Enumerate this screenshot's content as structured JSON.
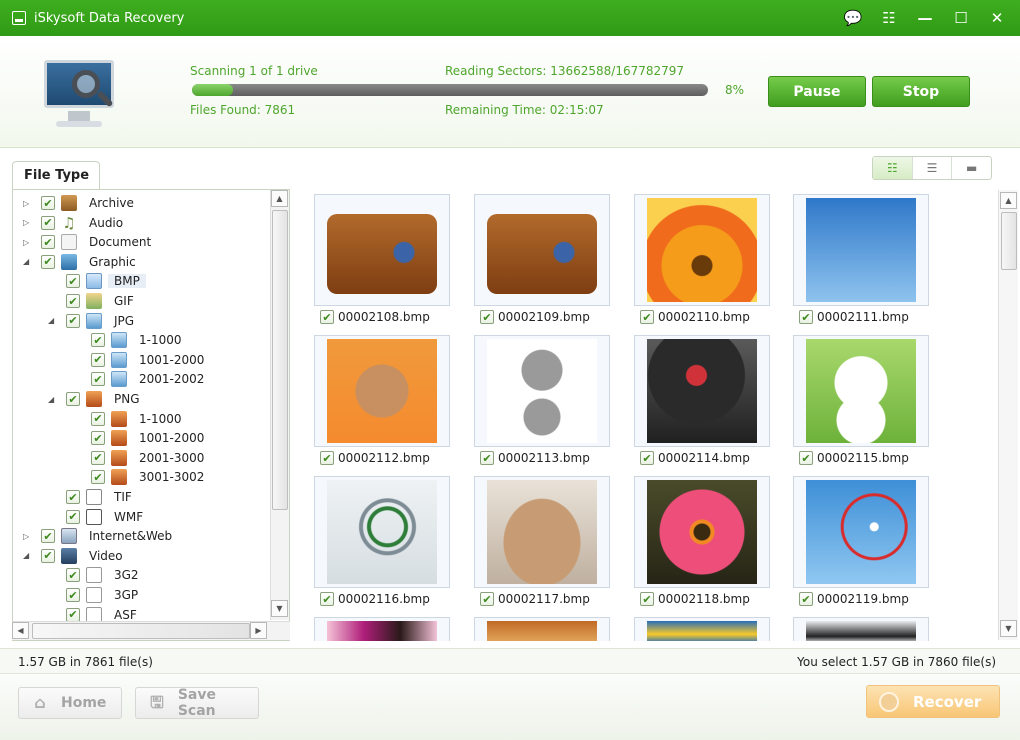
{
  "window": {
    "title": "iSkysoft Data Recovery"
  },
  "header": {
    "scan_status": "Scanning 1 of 1 drive",
    "reading_sectors": "Reading Sectors: 13662588/167782797",
    "files_found": "Files Found: 7861",
    "remaining_time": "Remaining Time: 02:15:07",
    "progress_percent": 8,
    "percent_label": "8%",
    "pause_label": "Pause",
    "stop_label": "Stop"
  },
  "sidebar": {
    "tab_label": "File Type",
    "tree": [
      {
        "label": "Archive",
        "icon": "archive-icon"
      },
      {
        "label": "Audio",
        "icon": "music-note-icon"
      },
      {
        "label": "Document",
        "icon": "document-icon"
      },
      {
        "label": "Graphic",
        "icon": "image-icon"
      },
      {
        "label": "BMP",
        "icon": "bmp-file-icon"
      },
      {
        "label": "GIF",
        "icon": "gif-file-icon"
      },
      {
        "label": "JPG",
        "icon": "jpg-file-icon"
      },
      {
        "label": "1-1000",
        "icon": "jpg-folder-icon"
      },
      {
        "label": "1001-2000",
        "icon": "jpg-folder-icon"
      },
      {
        "label": "2001-2002",
        "icon": "jpg-folder-icon"
      },
      {
        "label": "PNG",
        "icon": "png-file-icon"
      },
      {
        "label": "1-1000",
        "icon": "png-folder-icon"
      },
      {
        "label": "1001-2000",
        "icon": "png-folder-icon"
      },
      {
        "label": "2001-3000",
        "icon": "png-folder-icon"
      },
      {
        "label": "3001-3002",
        "icon": "png-folder-icon"
      },
      {
        "label": "TIF",
        "icon": "tif-file-icon"
      },
      {
        "label": "WMF",
        "icon": "wmf-file-icon"
      },
      {
        "label": "Internet&Web",
        "icon": "web-icon"
      },
      {
        "label": "Video",
        "icon": "film-icon"
      },
      {
        "label": "3G2",
        "icon": "blank-file-icon"
      },
      {
        "label": "3GP",
        "icon": "blank-file-icon"
      },
      {
        "label": "ASF",
        "icon": "blank-file-icon"
      }
    ]
  },
  "view_toggles": [
    "thumbnail-view-icon",
    "list-view-icon",
    "preview-view-icon"
  ],
  "files": [
    {
      "name": "00002108.bmp",
      "image": "suitcase"
    },
    {
      "name": "00002109.bmp",
      "image": "suitcase"
    },
    {
      "name": "00002110.bmp",
      "image": "orange flower"
    },
    {
      "name": "00002111.bmp",
      "image": "roller coaster"
    },
    {
      "name": "00002112.bmp",
      "image": "starfish"
    },
    {
      "name": "00002113.bmp",
      "image": "robot toy"
    },
    {
      "name": "00002114.bmp",
      "image": "vinyl record"
    },
    {
      "name": "00002115.bmp",
      "image": "lucky cat"
    },
    {
      "name": "00002116.bmp",
      "image": "gyroscope"
    },
    {
      "name": "00002117.bmp",
      "image": "kitten"
    },
    {
      "name": "00002118.bmp",
      "image": "pink flower"
    },
    {
      "name": "00002119.bmp",
      "image": "ferris wheel"
    }
  ],
  "status": {
    "left": "1.57 GB in 7861 file(s)",
    "right": "You select 1.57 GB in 7860 file(s)"
  },
  "bottom": {
    "home_label": "Home",
    "save_scan_label": "Save Scan",
    "recover_label": "Recover"
  },
  "colors": {
    "brand_green": "#3fae1f",
    "accent_text": "#4fa62c",
    "recover_orange": "#f8c675"
  }
}
